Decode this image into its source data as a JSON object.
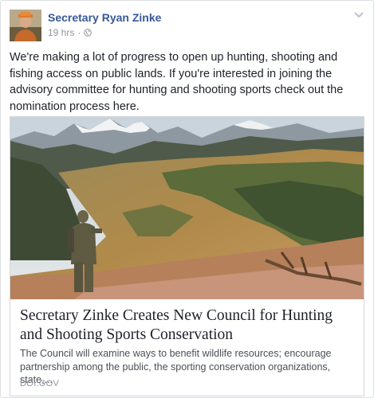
{
  "post": {
    "author": "Secretary Ryan Zinke",
    "time": "19 hrs",
    "separator": "·",
    "message": "We're making a lot of progress to open up hunting, shooting and fishing access on public lands. If you're interested in joining the advisory committee for hunting and shooting sports check out the nomination process here."
  },
  "link_preview": {
    "title": "Secretary Zinke Creates New Council for Hunting and Shooting Sports Conservation",
    "description": "The Council will examine ways to benefit wildlife resources; encourage partnership among the public, the sporting conservation organizations, state,...",
    "domain": "DOI.GOV"
  },
  "icons": {
    "privacy": "globe-icon",
    "menu": "chevron-down-icon"
  },
  "colors": {
    "author": "#365899",
    "text": "#1d2129",
    "meta": "#90949c"
  }
}
